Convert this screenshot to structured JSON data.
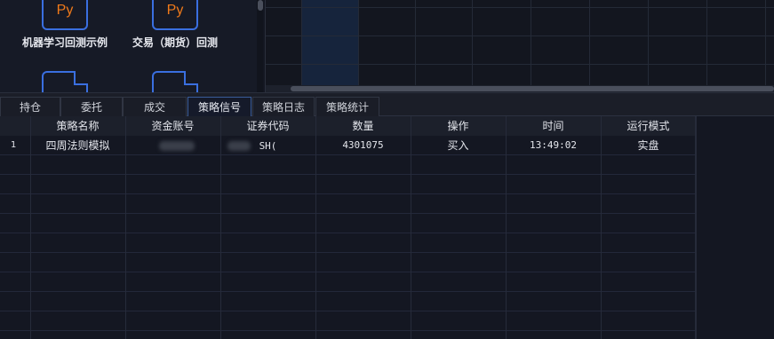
{
  "files": [
    {
      "icon_text": "Py",
      "label": "机器学习回测示例"
    },
    {
      "icon_text": "Py",
      "label": "交易（期货）回测"
    }
  ],
  "tabs": [
    {
      "label": "持仓",
      "active": false
    },
    {
      "label": "委托",
      "active": false
    },
    {
      "label": "成交",
      "active": false
    },
    {
      "label": "策略信号",
      "active": true
    },
    {
      "label": "策略日志",
      "active": false
    },
    {
      "label": "策略统计",
      "active": false
    }
  ],
  "table": {
    "columns": [
      "",
      "策略名称",
      "资金账号",
      "证券代码",
      "数量",
      "操作",
      "时间",
      "运行模式"
    ],
    "rows": [
      {
        "index": "1",
        "strategy": "四周法则模拟",
        "account": "",
        "code": "SH(",
        "qty": "4301075",
        "action": "买入",
        "time": "13:49:02",
        "mode": "实盘"
      }
    ]
  },
  "colors": {
    "accent_blue": "#3a6fe0",
    "py_orange": "#f07a1a",
    "background": "#141722"
  }
}
